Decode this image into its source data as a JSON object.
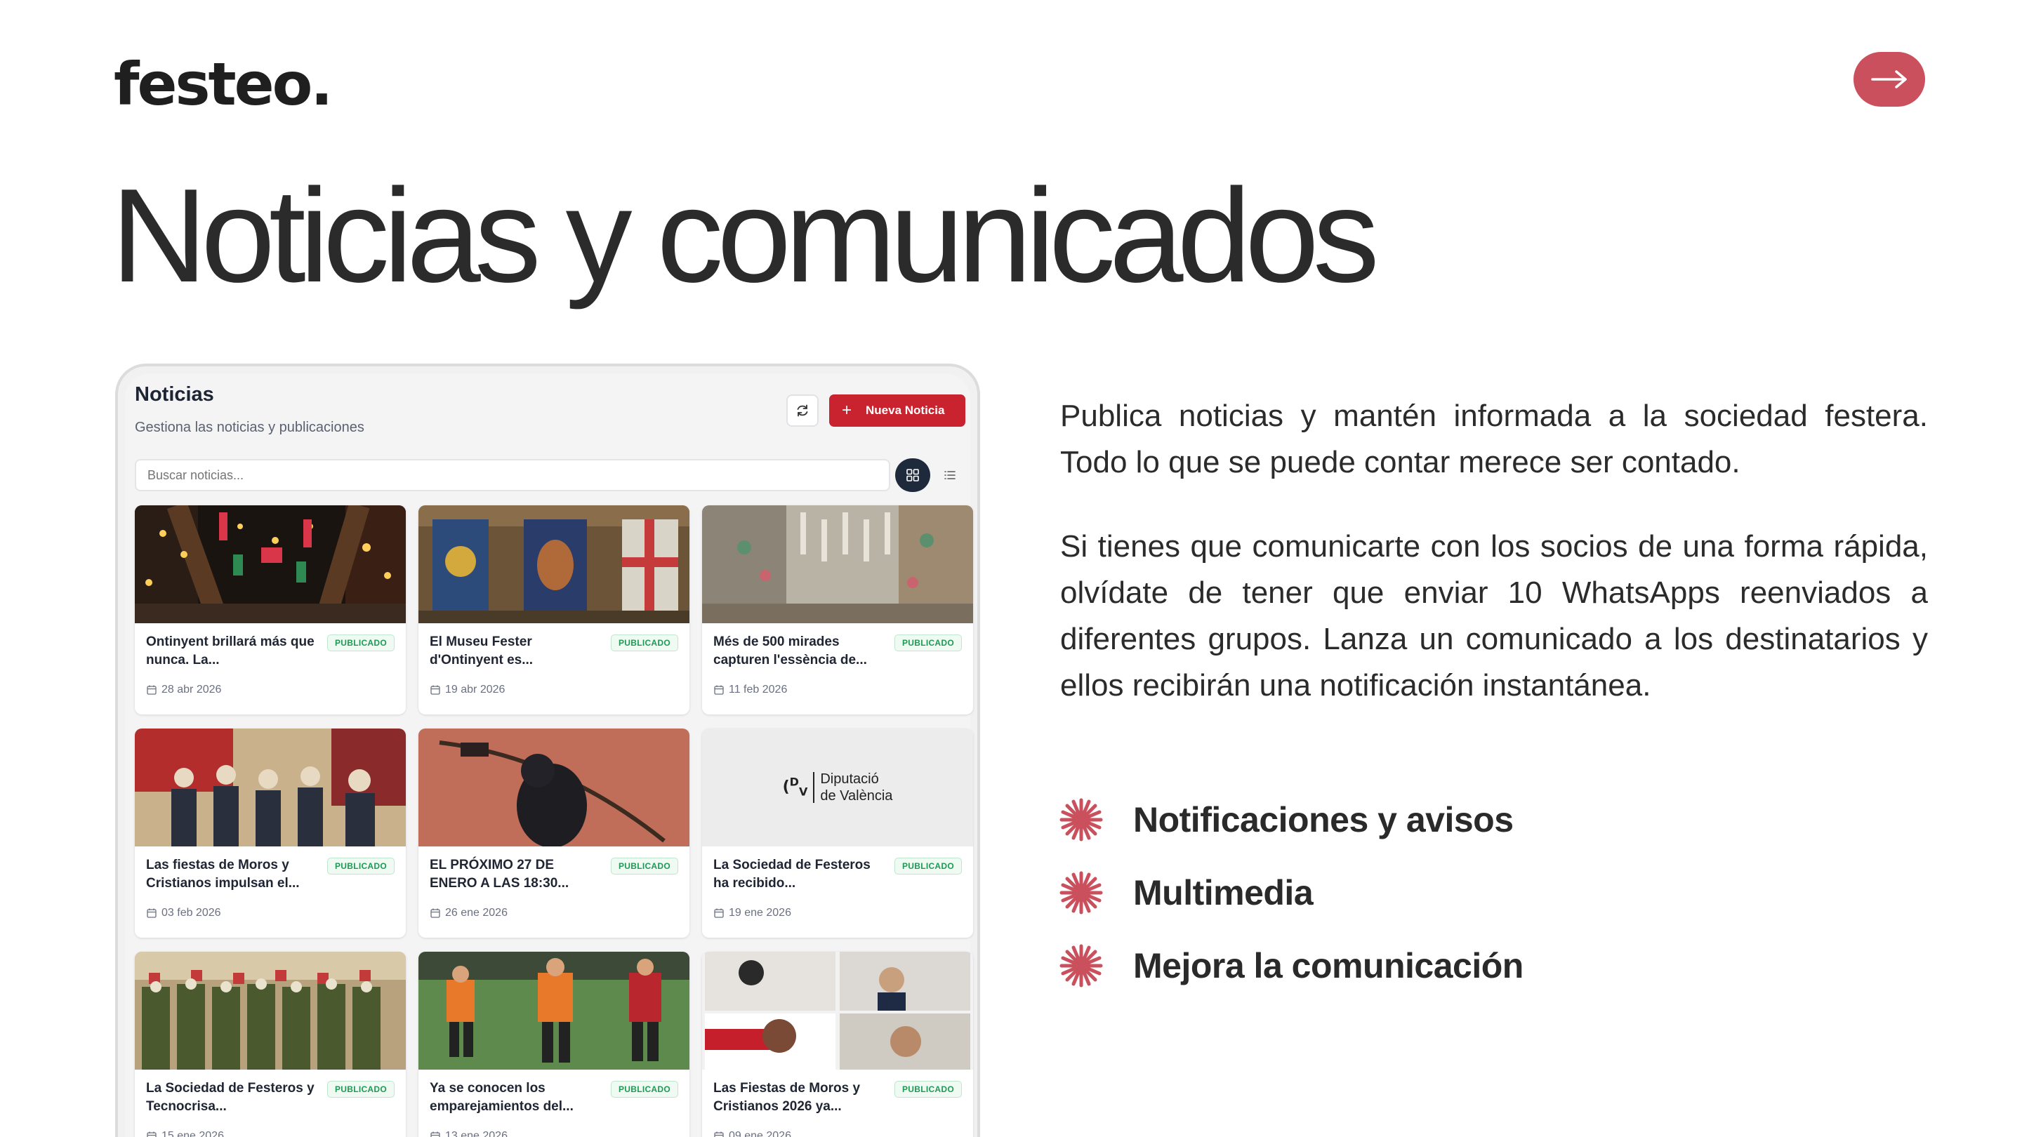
{
  "slide": {
    "logo": "festeo.",
    "title": "Noticias y comunicados",
    "paragraphs": [
      "Publica noticias y mantén informada a la sociedad festera. Todo lo que se puede contar merece ser contado.",
      "Si tienes que comunicarte con los socios de una forma rápida, olvídate de tener que enviar 10 WhatsApps reenviados a diferentes grupos. Lanza un comunicado a los destinatarios y ellos recibirán una notificación instantánea."
    ],
    "features": [
      {
        "label": "Notificaciones y avisos",
        "icon": "starburst-icon"
      },
      {
        "label": "Multimedia",
        "icon": "starburst-icon"
      },
      {
        "label": "Mejora la comunicación",
        "icon": "starburst-icon"
      }
    ],
    "next_icon": "arrow-right-icon",
    "accent_color": "#c9505c"
  },
  "app": {
    "title": "Noticias",
    "subtitle": "Gestiona las noticias y publicaciones",
    "new_button_label": "Nueva Noticia",
    "search_placeholder": "Buscar noticias...",
    "primary_color": "#c8232f",
    "cards": [
      {
        "title": "Ontinyent brillará más que nunca. La...",
        "status": "PUBLICADO",
        "date": "28 abr 2026",
        "image": "street-lights-photo"
      },
      {
        "title": "El Museu Fester d'Ontinyent es...",
        "status": "PUBLICADO",
        "date": "19 abr 2026",
        "image": "banners-photo"
      },
      {
        "title": "Més de 500 mirades capturen l'essència de...",
        "status": "PUBLICADO",
        "date": "11 feb 2026",
        "image": "street-decor-photo"
      },
      {
        "title": "Las fiestas de Moros y Cristianos impulsan el...",
        "status": "PUBLICADO",
        "date": "03 feb 2026",
        "image": "group-visit-photo"
      },
      {
        "title": "EL PRÓXIMO 27 DE ENERO A LAS 18:30...",
        "status": "PUBLICADO",
        "date": "26 ene 2026",
        "image": "archer-photo"
      },
      {
        "title": "La Sociedad de Festeros ha recibido...",
        "status": "PUBLICADO",
        "date": "19 ene 2026",
        "image": "diputacio-logo",
        "logo_text": [
          "Diputació",
          "de València"
        ]
      },
      {
        "title": "La Sociedad de Festeros y Tecnocrisa...",
        "status": "PUBLICADO",
        "date": "15 ene 2026",
        "image": "parade-photo"
      },
      {
        "title": "Ya se conocen los emparejamientos del...",
        "status": "PUBLICADO",
        "date": "13 ene 2026",
        "image": "football-photo"
      },
      {
        "title": "Las Fiestas de Moros y Cristianos 2026 ya...",
        "status": "PUBLICADO",
        "date": "09 ene 2026",
        "image": "collage-photo"
      }
    ]
  }
}
